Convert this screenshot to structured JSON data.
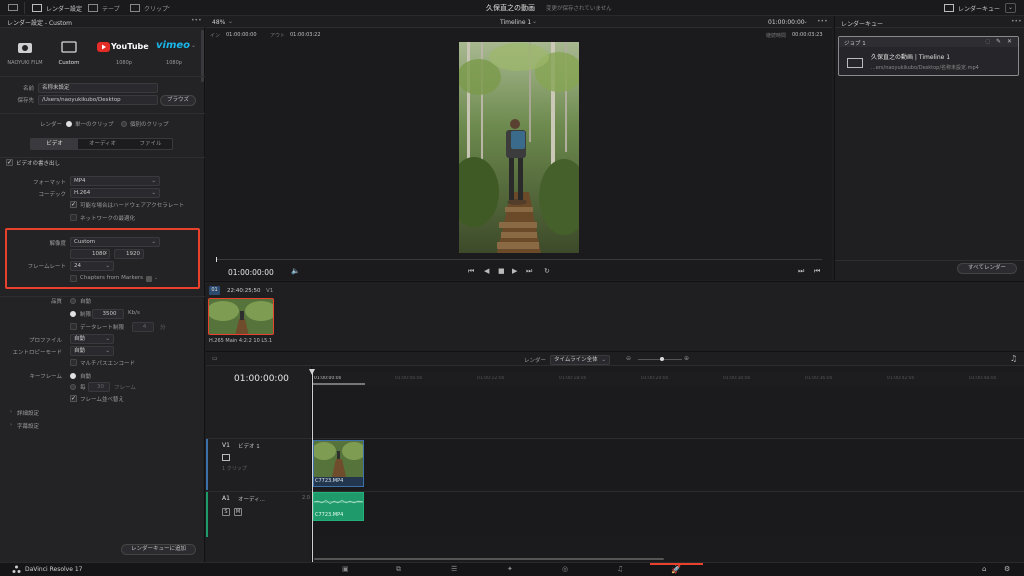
{
  "topbar": {
    "render_settings_label": "レンダー設定",
    "tape_label": "テープ",
    "clip_label": "クリップ",
    "project_title": "久保直之の動画",
    "save_status": "変更が保存されていません",
    "render_queue_label": "レンダーキュー"
  },
  "left": {
    "panel_title": "レンダー設定 - Custom",
    "presets": [
      {
        "label": "NAOYUKI FILM"
      },
      {
        "label": "Custom"
      },
      {
        "label": "1080p",
        "brand": "YouTube"
      },
      {
        "label": "1080p",
        "brand": "vimeo"
      }
    ],
    "name_label": "名前",
    "name_value": "名称未設定",
    "save_to_label": "保存先",
    "save_to_value": "/Users/naoyukikubo/Desktop",
    "browse_button": "ブラウズ",
    "render_label": "レンダー",
    "single_clip": "単一のクリップ",
    "individual_clips": "個別のクリップ",
    "tabs": [
      "ビデオ",
      "オーディオ",
      "ファイル"
    ],
    "export_video": "ビデオの書き出し",
    "format_label": "フォーマット",
    "format_value": "MP4",
    "codec_label": "コーデック",
    "codec_value": "H.264",
    "hw_accel": "可能な場合はハードウェアアクセラレート",
    "network_opt": "ネットワークの最適化",
    "resolution_label": "解像度",
    "resolution_value": "Custom",
    "res_w": "1080",
    "res_x": "x",
    "res_h": "1920",
    "framerate_label": "フレームレート",
    "framerate_value": "24",
    "chapters": "Chapters from Markers",
    "quality_label": "品質",
    "quality_auto": "自動",
    "quality_limit": "制限",
    "quality_limit_value": "3500",
    "quality_unit": "Kb/s",
    "datarate_limit": "データレート制限",
    "datarate_value": "4",
    "datarate_unit": "分",
    "profile_label": "プロファイル",
    "profile_value": "自動",
    "entropy_label": "エントロピーモード",
    "entropy_value": "自動",
    "multipass": "マルチパスエンコード",
    "keyframe_label": "キーフレーム",
    "keyframe_auto": "自動",
    "keyframe_every": "毎",
    "keyframe_every_value": "30",
    "keyframe_unit": "フレーム",
    "frame_reorder": "フレーム並べ替え",
    "advanced": "詳細設定",
    "subtitles": "字幕設定",
    "add_to_queue": "レンダーキューに追加"
  },
  "viewer": {
    "zoom": "48%",
    "timeline_name": "Timeline 1",
    "timecode_top": "01:00:00:00",
    "in_label": "イン",
    "in_tc": "01:00:00:00",
    "out_label": "アウト",
    "out_tc": "01:00:03:22",
    "duration_label": "継続時間",
    "duration_tc": "00:00:03:23",
    "playhead_tc": "01:00:00:00"
  },
  "clipbar": {
    "clip_num": "01",
    "clip_tc": "22:40:25;50",
    "track": "V1",
    "codec_info": "H.265 Main 4:2:2 10 L5.1"
  },
  "timeline": {
    "render_label": "レンダー",
    "render_range": "タイムライン全体",
    "timecode": "01:00:00:00",
    "ruler": [
      "01:00:00:00",
      "01:00:06:00",
      "01:00:12:00",
      "01:00:18:00",
      "01:00:24:00",
      "01:00:30:00",
      "01:00:36:00",
      "01:00:42:00",
      "01:00:48:00"
    ],
    "v1_label": "V1",
    "v1_name": "ビデオ 1",
    "v1_count": "1 クリップ",
    "a1_label": "A1",
    "a1_name": "オーディ...",
    "a1_level": "2.0",
    "s_btn": "S",
    "m_btn": "M",
    "clip_name_v": "C7723.MP4",
    "clip_name_a": "C7723.MP4"
  },
  "queue": {
    "title": "レンダーキュー",
    "job_label": "ジョブ 1",
    "job_title": "久保直之の動画 | Timeline 1",
    "job_path": "...ers/naoyukikubo/Desktop/名称未設定.mp4",
    "render_all": "すべてレンダー"
  },
  "footer": {
    "app_name": "DaVinci Resolve 17"
  },
  "colors": {
    "highlight": "#e8412c",
    "audio_clip": "#1f9a6a",
    "video_track": "#3d6fa8",
    "active_page": "#e8412c"
  }
}
